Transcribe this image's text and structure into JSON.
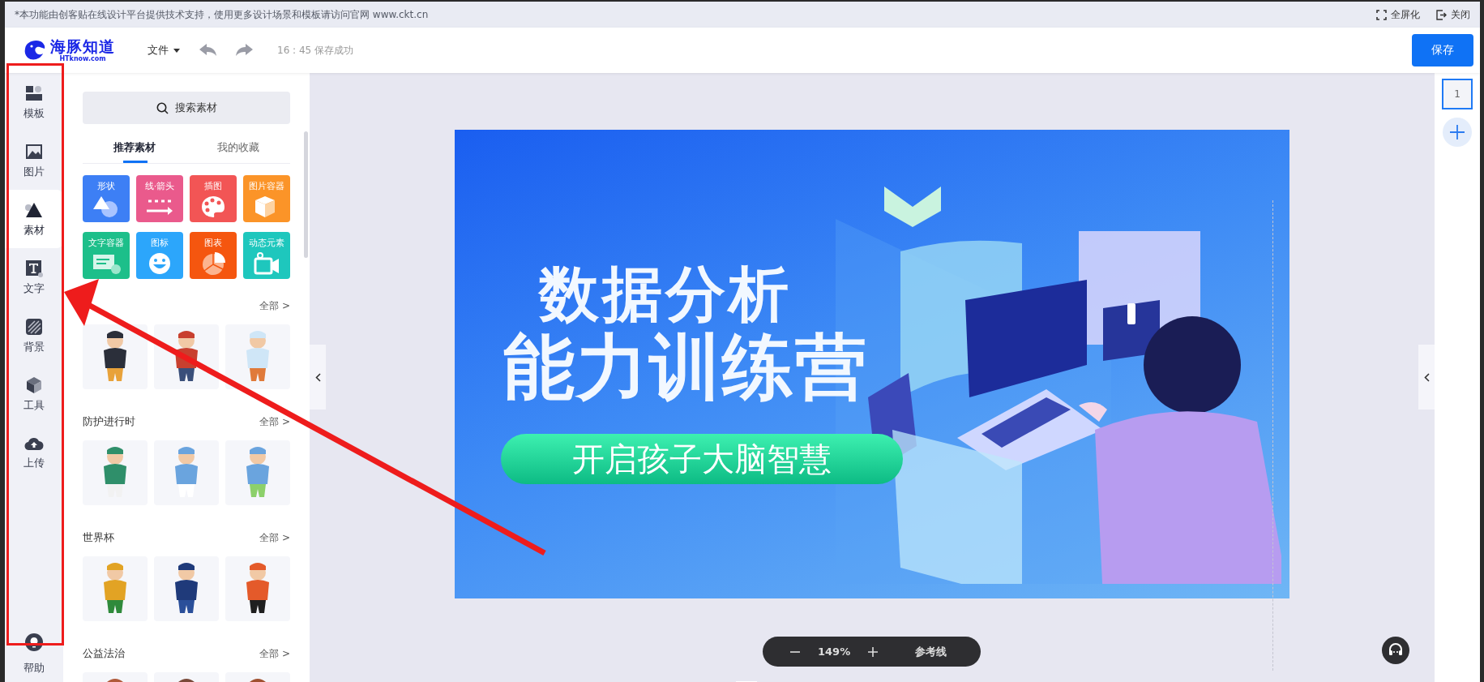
{
  "notice": {
    "text": "*本功能由创客贴在线设计平台提供技术支持，使用更多设计场景和模板请访问官网 www.ckt.cn",
    "actions": [
      "全屏化",
      "关闭"
    ]
  },
  "header": {
    "logo": {
      "name": "海豚知道",
      "domain": "HTknow.com"
    },
    "file_menu": "文件",
    "save_status": "16 : 45 保存成功",
    "save_button": "保存"
  },
  "rail": {
    "items": [
      {
        "label": "模板",
        "selected": false
      },
      {
        "label": "图片",
        "selected": false
      },
      {
        "label": "素材",
        "selected": true
      },
      {
        "label": "文字",
        "selected": false
      },
      {
        "label": "背景",
        "selected": false
      },
      {
        "label": "工具",
        "selected": false
      },
      {
        "label": "上传",
        "selected": false
      }
    ],
    "help": "帮助"
  },
  "panel": {
    "search": {
      "placeholder": "搜索素材"
    },
    "tabs": [
      {
        "label": "推荐素材",
        "selected": true
      },
      {
        "label": "我的收藏",
        "selected": false
      }
    ],
    "categories": [
      {
        "label": "形状",
        "color": "#3d7ff5"
      },
      {
        "label": "线·箭头",
        "color": "#ea5a8c"
      },
      {
        "label": "插图",
        "color": "#f25555"
      },
      {
        "label": "图片容器",
        "color": "#fb9428"
      },
      {
        "label": "文字容器",
        "color": "#1dbf8a"
      },
      {
        "label": "图标",
        "color": "#2ca6fb"
      },
      {
        "label": "图表",
        "color": "#f5560f"
      },
      {
        "label": "动态元素",
        "color": "#1ec7bd"
      }
    ],
    "sections": [
      {
        "more": "全部 >"
      },
      {
        "title": "防护进行时",
        "more": "全部 >"
      },
      {
        "title": "世界杯",
        "more": "全部 >"
      },
      {
        "title": "公益法治",
        "more": "全部 >"
      }
    ]
  },
  "canvas": {
    "title_line_1": "数据分析",
    "title_line_2": "能力训练营",
    "tagline": "开启孩子大脑智慧"
  },
  "zoom": {
    "value": "149%",
    "guides": "参考线"
  },
  "pages": [
    {
      "number": "1",
      "selected": true
    }
  ]
}
